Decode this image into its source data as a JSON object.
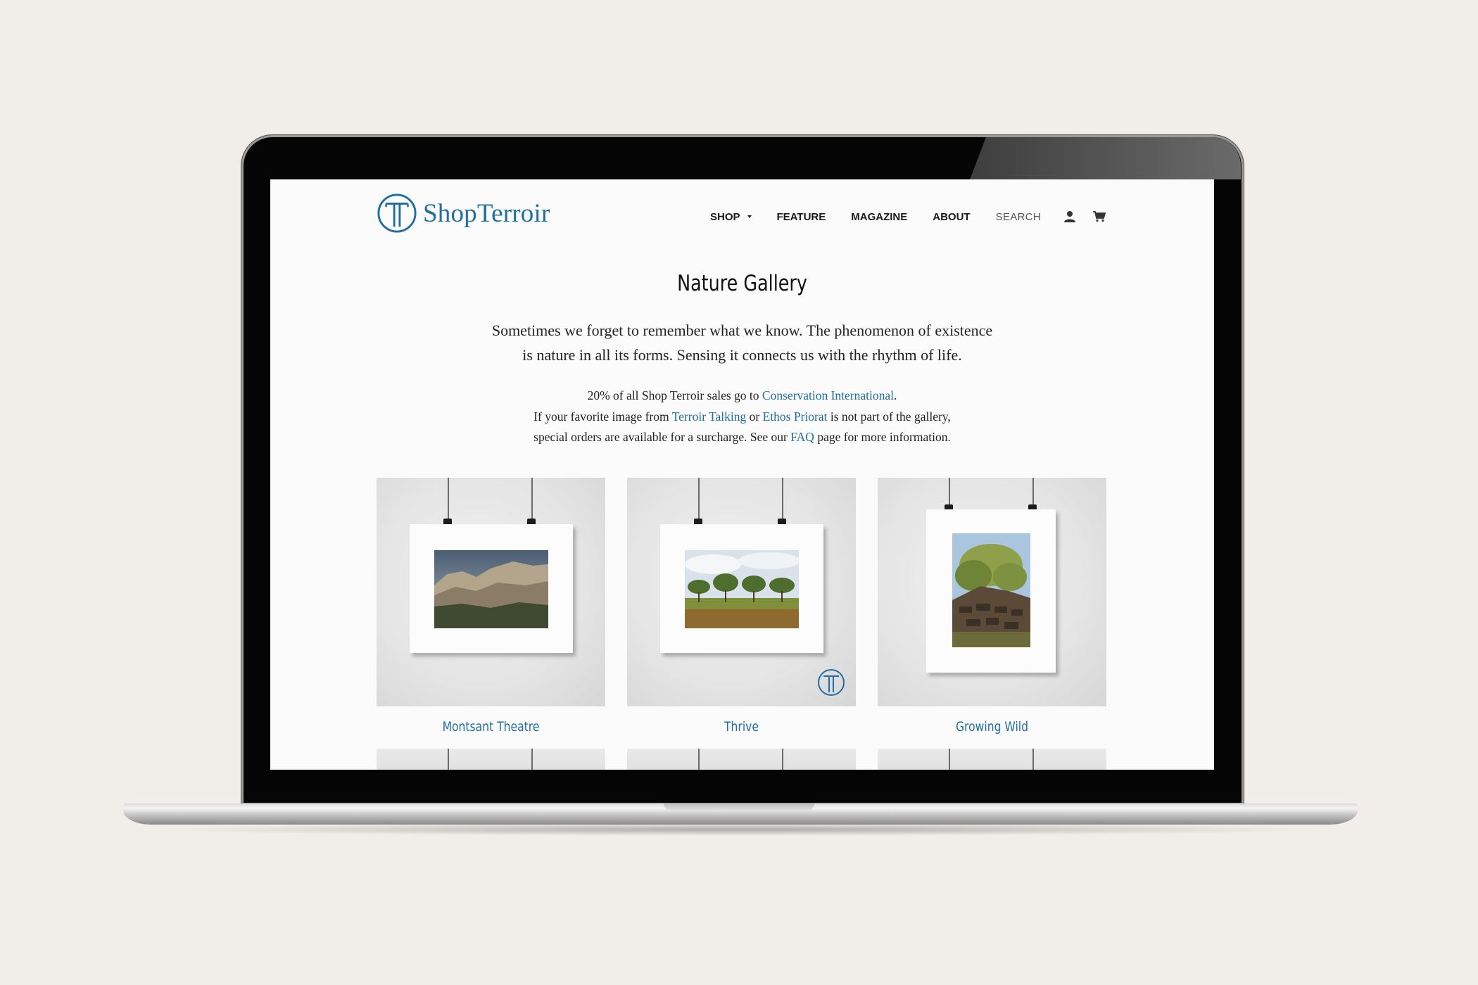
{
  "brand": {
    "name": "ShopTerroir",
    "accent": "#1f6fa1"
  },
  "nav": {
    "shop": "SHOP",
    "feature": "FEATURE",
    "magazine": "MAGAZINE",
    "about": "ABOUT",
    "search": "SEARCH",
    "account_icon": "user-icon",
    "cart_icon": "cart-icon"
  },
  "page": {
    "title": "Nature Gallery",
    "intro_line1": "Sometimes we forget to remember what we know. The phenomenon of existence",
    "intro_line2": "is nature in all its forms. Sensing it connects us with the rhythm of life.",
    "note": {
      "l1_pre": "20% of all Shop Terroir sales go to ",
      "l1_link": "Conservation International",
      "l1_post": ".",
      "l2_pre": "If your favorite image from ",
      "l2_link1": "Terroir Talking",
      "l2_mid": " or ",
      "l2_link2": "Ethos Priorat",
      "l2_post": " is not part of the gallery,",
      "l3_pre": "special orders are available for a surcharge. See our ",
      "l3_link": "FAQ",
      "l3_post": " page for more information."
    }
  },
  "gallery": [
    {
      "title": "Montsant Theatre"
    },
    {
      "title": "Thrive"
    },
    {
      "title": "Growing Wild"
    }
  ]
}
